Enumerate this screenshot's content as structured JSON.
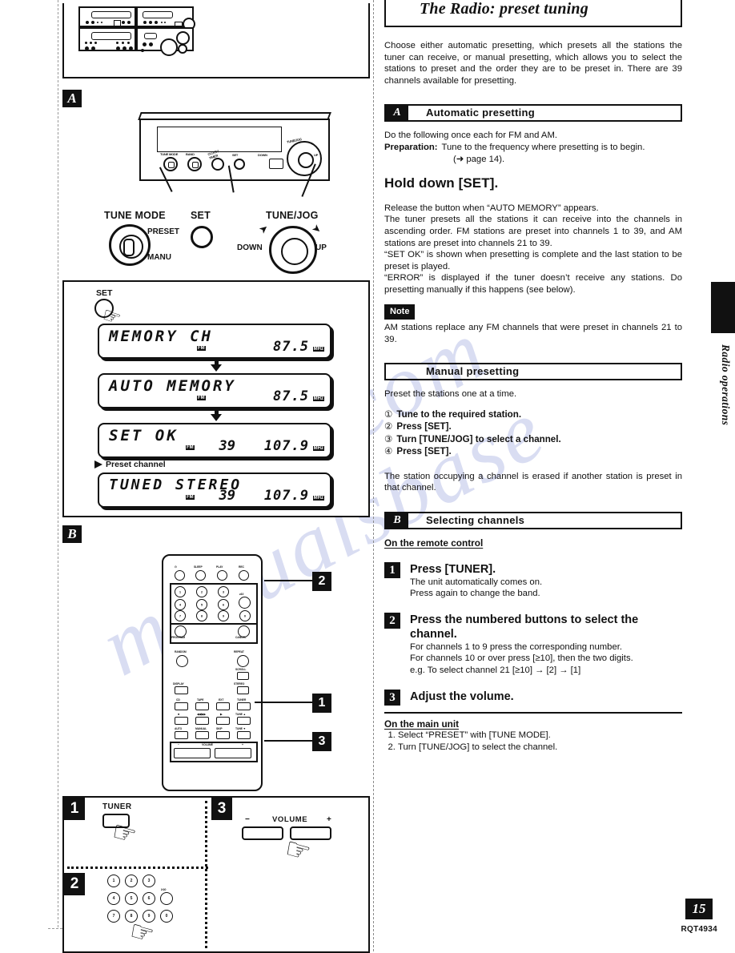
{
  "document": {
    "page_number": "15",
    "doc_code": "RQT4934",
    "side_tab": "Radio operations",
    "watermark_a": "manualsbase",
    "watermark_b": ".com"
  },
  "header": {
    "title": "The Radio: preset tuning",
    "intro": "Choose either automatic presetting, which presets all the stations the tuner can receive, or manual presetting, which allows you to select the stations to preset and the order they are to be preset in. There are 39 channels available for presetting."
  },
  "section_a": {
    "badge": "A",
    "label": "Automatic presetting",
    "line1": "Do the following once each for FM and AM.",
    "prep_key": "Preparation:",
    "prep_value": "Tune to the frequency where presetting is to begin.",
    "prep_ref": "(➜ page 14).",
    "action": "Hold down [SET].",
    "p1": "Release the button when “AUTO MEMORY” appears.",
    "p2": "The tuner presets all the stations it can receive into the channels in ascending order. FM stations are preset into channels 1 to 39, and AM stations are preset into channels 21 to 39.",
    "p3": "“SET OK” is shown when presetting is complete and the last station to be preset is played.",
    "p4": "“ERROR” is displayed if the tuner doesn’t receive any stations. Do presetting manually if this happens (see below).",
    "note_tag": "Note",
    "note_text": "AM stations replace any FM channels that were preset in channels 21 to 39."
  },
  "section_manual": {
    "label": "Manual presetting",
    "intro": "Preset the stations one at a time.",
    "steps": [
      {
        "num": "①",
        "text": "Tune to the required station."
      },
      {
        "num": "②",
        "text": "Press [SET]."
      },
      {
        "num": "③",
        "text": "Turn [TUNE/JOG] to select a channel."
      },
      {
        "num": "④",
        "text": "Press [SET]."
      }
    ],
    "outro": "The station occupying a channel is erased if another station is preset in that channel."
  },
  "section_b": {
    "badge": "B",
    "label": "Selecting channels",
    "remote_head": "On the remote control",
    "steps": [
      {
        "num": "1",
        "head": "Press [TUNER].",
        "sub": [
          "The unit automatically comes on.",
          "Press again to change the band."
        ]
      },
      {
        "num": "2",
        "head": "Press the numbered buttons to select the channel.",
        "sub": [
          "For channels 1 to 9 press the corresponding number.",
          "For channels 10 or over press [≥10], then the two digits.",
          "e.g. To select channel 21  [≥10] → [2] → [1]"
        ]
      },
      {
        "num": "3",
        "head": "Adjust the volume.",
        "sub": []
      }
    ],
    "main_unit_head": "On the main unit",
    "main_unit_steps": [
      "Select “PRESET” with [TUNE MODE].",
      "Turn [TUNE/JOG] to select the channel."
    ]
  },
  "figure_a": {
    "badge": "A",
    "callouts": [
      {
        "title": "TUNE MODE",
        "sub_a": "PRESET",
        "sub_b": "MANU"
      },
      {
        "title": "SET"
      },
      {
        "title": "TUNE/JOG",
        "sub_a": "DOWN",
        "sub_b": "UP"
      }
    ],
    "panel_labels": [
      "TUNE MODE",
      "BAND",
      "CLOCK/TIMER",
      "SET",
      "DOWN",
      "UP",
      "TUNE/JOG"
    ],
    "set_press_label": "SET",
    "displays": [
      {
        "main": "MEMORY CH",
        "band": "FM",
        "channel": "",
        "freq": "87.5",
        "unit": "MHz"
      },
      {
        "main": "AUTO MEMORY",
        "band": "FM",
        "channel": "",
        "freq": "87.5",
        "unit": "MHz"
      },
      {
        "main": "SET OK",
        "band": "FM",
        "channel": "39",
        "freq": "107.9",
        "unit": "MHz"
      },
      {
        "main": "TUNED STEREO",
        "band": "FM",
        "channel": "39",
        "freq": "107.9",
        "unit": "MHz"
      }
    ],
    "preset_channel_label": "Preset channel"
  },
  "figure_b": {
    "badge": "B",
    "markers": [
      "2",
      "1",
      "3"
    ],
    "remote": {
      "top_row": [
        "⏻",
        "SLEEP",
        "PLAY",
        "REC"
      ],
      "keypad": [
        "1",
        "2",
        "3",
        "4",
        "5",
        "6",
        "7",
        "8",
        "9",
        "0",
        "≥10"
      ],
      "program": "PROGRAM",
      "cancel": "CANCEL",
      "random": "RANDOM",
      "repeat": "REPEAT",
      "scroll": "SCROLL",
      "display": "DISPLAY",
      "stereo": "STEREO",
      "source_row": [
        "CD",
        "TAPE",
        "EXT",
        "TUNER"
      ],
      "transport_row": [
        "■",
        "◀◀/▶▶",
        "▶",
        "TUNE ▲"
      ],
      "transport_row2": [
        "AUTO",
        "MANUAL",
        "SKIP",
        "TUNE ▼"
      ],
      "volume_label": "VOLUME",
      "volume_minus": "−",
      "volume_plus": "+"
    }
  },
  "figure_detail": {
    "panels": [
      {
        "num": "1",
        "label": "TUNER"
      },
      {
        "num": "2",
        "keys": [
          "1",
          "2",
          "3",
          "4",
          "5",
          "6",
          "7",
          "8",
          "9",
          "0",
          "≥10"
        ]
      },
      {
        "num": "3",
        "label": "VOLUME",
        "minus": "−",
        "plus": "+"
      }
    ]
  }
}
